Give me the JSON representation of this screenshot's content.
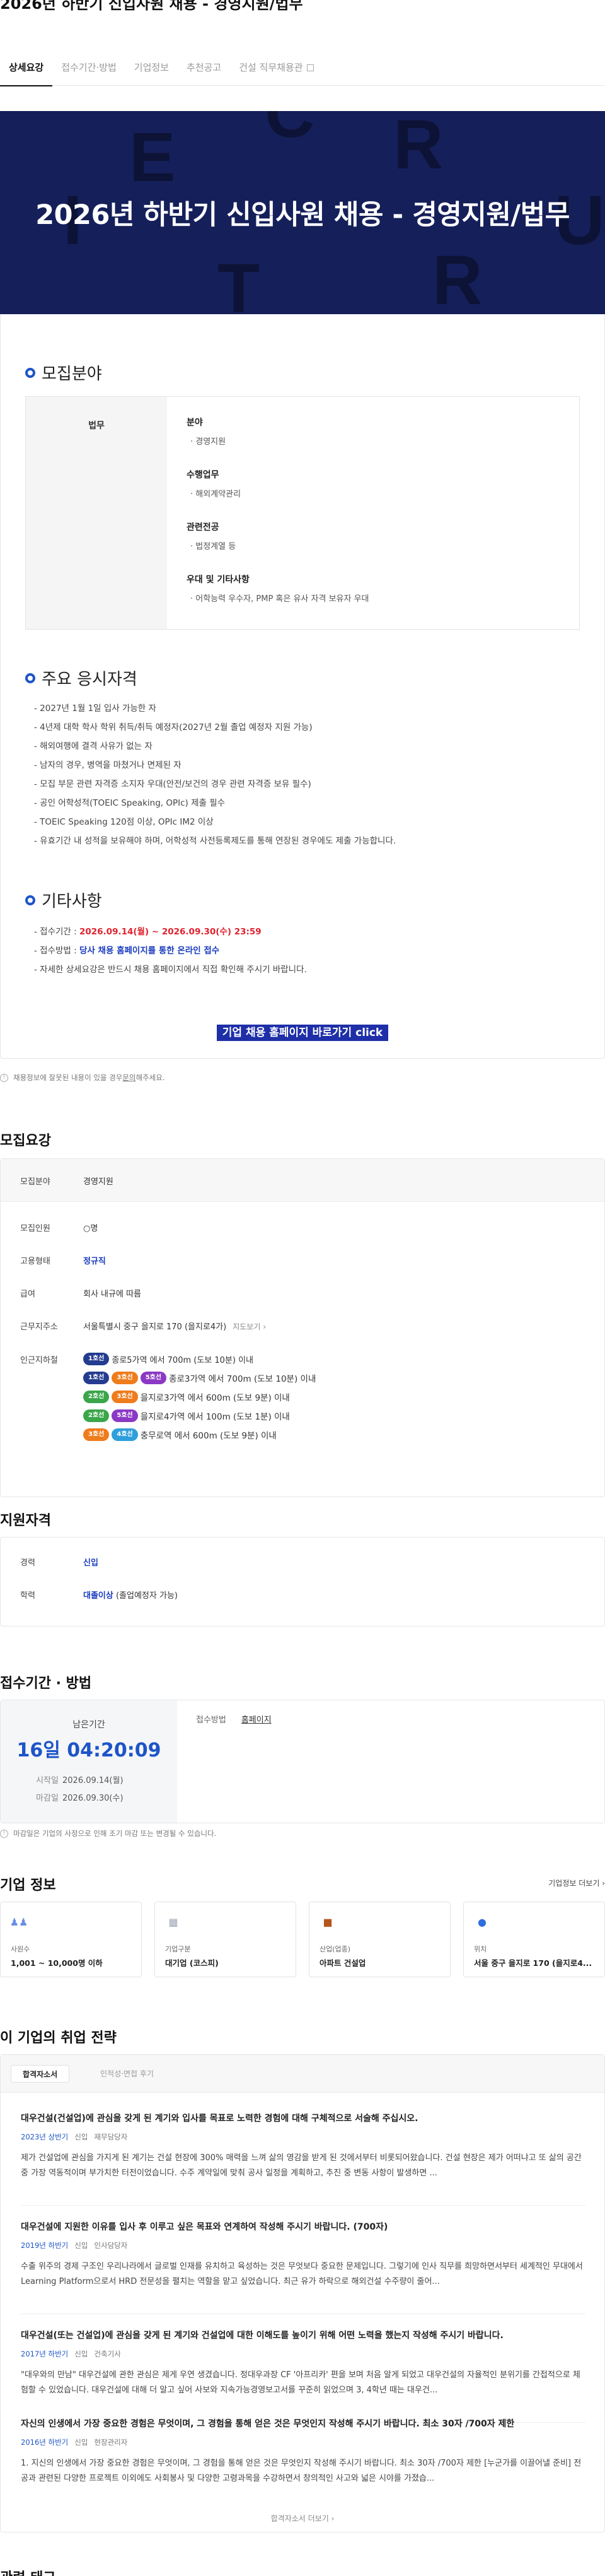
{
  "page_title": "2026년 하반기 신입사원 채용 - 경영지원/법무",
  "tabs": [
    {
      "label": "상세요강"
    },
    {
      "label": "접수기간·방법"
    },
    {
      "label": "기업정보"
    },
    {
      "label": "추천공고"
    },
    {
      "label": "건설 직무채용관"
    }
  ],
  "hero": {
    "title": "2026년 하반기 신입사원 채용 - 경영지원/법무",
    "bg_letters": [
      "R",
      "E",
      "C",
      "R",
      "U",
      "I",
      "T"
    ]
  },
  "recruit_field": {
    "heading": "모집분야",
    "category": "법무",
    "groups": [
      {
        "head": "분야",
        "item": "경영지원"
      },
      {
        "head": "수행업무",
        "item": "해외계약관리"
      },
      {
        "head": "관련전공",
        "item": "법정계열 등"
      },
      {
        "head": "우대 및 기타사항",
        "item": "어학능력 우수자, PMP 혹은 유사 자격 보유자 우대"
      }
    ]
  },
  "requirements": {
    "heading": "주요 응시자격",
    "items": [
      "2027년 1월 1일 입사 가능한 자",
      "4년제 대학 학사 학위 취득/취득 예정자(2027년 2월 졸업 예정자 지원 가능)",
      "해외여행에 결격 사유가 없는 자",
      "남자의 경우, 병역을 마쳤거나 면제된 자",
      "모집 부문 관련 자격증 소지자 우대(안전/보건의 경우 관련 자격증 보유 필수)",
      "공인 어학성적(TOEIC Speaking, OPIc) 제출 필수",
      "TOEIC Speaking 120점 이상, OPIc IM2 이상",
      "유효기간 내 성적을 보유해야 하며, 어학성적 사전등록제도를 통해 연장된 경우에도 제출 가능합니다."
    ]
  },
  "etc": {
    "heading": "기타사항",
    "period_label": "접수기간 : ",
    "period_value": "2026.09.14(월) ~ 2026.09.30(수) 23:59",
    "method_label": "접수방법 : ",
    "method_value": "당사 채용 홈페이지를 통한 온라인 접수",
    "note": "자세한 상세요강은 반드시 채용 홈페이지에서 직접 확인해 주시기 바랍니다.",
    "cta": "기업 채용 홈페이지 바로가기 click"
  },
  "notice1": {
    "text": "채용정보에 잘못된 내용이 있을 경우 ",
    "link": "문의",
    "tail": "해주세요."
  },
  "summary": {
    "heading": "모집요강",
    "rows": [
      {
        "k": "모집분야",
        "v": "경영지원"
      },
      {
        "k": "모집인원",
        "v": "○명"
      },
      {
        "k": "고용형태",
        "v": "정규직"
      },
      {
        "k": "급여",
        "v": "회사 내규에 따름"
      },
      {
        "k": "근무지주소",
        "v": "서울특별시 중구 을지로 170 (을지로4가)",
        "more": "지도보기"
      },
      {
        "k": "인근지하철"
      }
    ],
    "subway": [
      {
        "pills": [
          "1호선"
        ],
        "text": "종로5가역 에서 700m (도보 10분) 이내"
      },
      {
        "pills": [
          "1호선",
          "3호선",
          "5호선"
        ],
        "text": "종로3가역 에서 700m (도보 10분) 이내"
      },
      {
        "pills": [
          "2호선",
          "3호선"
        ],
        "text": "을지로3가역 에서 600m (도보 9분) 이내"
      },
      {
        "pills": [
          "2호선",
          "5호선"
        ],
        "text": "을지로4가역 에서 100m (도보 1분) 이내"
      },
      {
        "pills": [
          "3호선",
          "4호선"
        ],
        "text": "충무로역 에서 600m (도보 9분) 이내"
      }
    ]
  },
  "qualification": {
    "heading": "지원자격",
    "rows": [
      {
        "k": "경력",
        "v": "신입"
      },
      {
        "k": "학력",
        "v_bold": "대졸이상",
        "v_rest": " (졸업예정자 가능)"
      }
    ]
  },
  "application": {
    "heading": "접수기간 · 방법",
    "remain_label": "남은기간",
    "remain_value": "16일 04:20:09",
    "start_label": "시작일",
    "start_value": "2026.09.14(월)",
    "end_label": "마감일",
    "end_value": "2026.09.30(수)",
    "method_label": "접수방법",
    "method_value": "홈페이지"
  },
  "notice2": {
    "text": "마감일은 기업의 사정으로 인해 조기 마감 또는 변경될 수 있습니다."
  },
  "company": {
    "heading": "기업 정보",
    "more": "기업정보 더보기",
    "cards": [
      {
        "icon": "people-icon",
        "label": "사원수",
        "value": "1,001 ~ 10,000명 이하"
      },
      {
        "icon": "building-icon",
        "label": "기업구분",
        "value": "대기업 (코스피)"
      },
      {
        "icon": "briefcase-icon",
        "label": "산업(업종)",
        "value": "아파트 건설업"
      },
      {
        "icon": "location-icon",
        "label": "위치",
        "value": "서울 중구 을지로 170 (을지로4..."
      }
    ]
  },
  "strategy": {
    "heading": "이 기업의 취업 전략",
    "tabs": [
      "합격자소서",
      "인적성·면접 후기"
    ],
    "items": [
      {
        "title": "대우건설(건설업)에 관심을 갖게 된 계기와 입사를 목표로 노력한 경험에 대해 구체적으로 서술해 주십시오.",
        "year": "2023년 상반기",
        "type": "신입",
        "role": "재무담당자",
        "desc": "제가 건설업에 관심을 가지게 된 계기는 건설 현장에 300% 매력을 느껴 삶의 영감을 받게 된 것에서부터 비롯되어왔습니다. 건설 현장은 제가 어떠냐고 또 삶의 공간 중 가장 역동적이며 부가치한 터전이었습니다. 수주 계약일에 맞춰 공사 일정을 계획하고, 추진 중 변동 사항이 발생하면 ..."
      },
      {
        "title": "대우건설에 지원한 이유를 입사 후 이루고 싶은 목표와 연계하여 작성해 주시기 바랍니다. (700자)",
        "year": "2019년 하반기",
        "type": "신입",
        "role": "인사담당자",
        "desc": "수출 위주의 경제 구조인 우리나라에서 글로벌 인재를 유치하고 육성하는 것은 무엇보다 중요한 문제입니다. 그렇기에 인사 직무를 희망하면서부터 세계적인 무대에서 Learning Platform으로서 HRD 전문성을 펼치는 역할을 맡고 싶었습니다. 최근 유가 하락으로 해외건설 수주량이 줄어..."
      },
      {
        "title": "대우건설(또는 건설업)에 관심을 갖게 된 계기와 건설업에 대한 이해도를 높이기 위해 어떤 노력을 했는지 작성해 주시기 바랍니다.",
        "year": "2017년 하반기",
        "type": "신입",
        "role": "건축기사",
        "desc": "\"대우와의 만남\" 대우건설에 관한 관심은 제게 우연 생겼습니다. 정대우과장 CF '아프리카' 편을 보며 처음 알게 되었고 대우건설의 자율적인 분위기를 간접적으로 체험할 수 있었습니다. 대우건설에 대해 더 알고 싶어 사보와 지속가능경영보고서를 꾸준히 읽었으며 3, 4학년 때는 대우건..."
      },
      {
        "title": "자신의 인생에서 가장 중요한 경험은 무엇이며, 그 경험을 통해 얻은 것은 무엇인지 작성해 주시기 바랍니다. 최소 30자 /700자 제한",
        "year": "2016년 하반기",
        "type": "신입",
        "role": "현장관리자",
        "desc": "1. 지신의 인생에서 가장 중요한 경험은 무엇이며, 그 경험을 통해 얻은 것은 무엇인지 작성해 주시기 바랍니다. 최소 30자 /700자 제한 [누군가를 이끌어낼 준비] 전공과 관련된 다양한 프로젝트 이외에도 사회봉사 및 다양한 고령과목을 수강하면서 창의적인 사고와 넓은 시야를 가졌습..."
      }
    ],
    "more": "합격자소서 더보기"
  },
  "bottom_heading": "관련 태그",
  "colors": {
    "accent": "#1d54c8",
    "hero_bg": "#15205a",
    "red": "#e0222e",
    "cta_bg": "#1e2fa8"
  }
}
